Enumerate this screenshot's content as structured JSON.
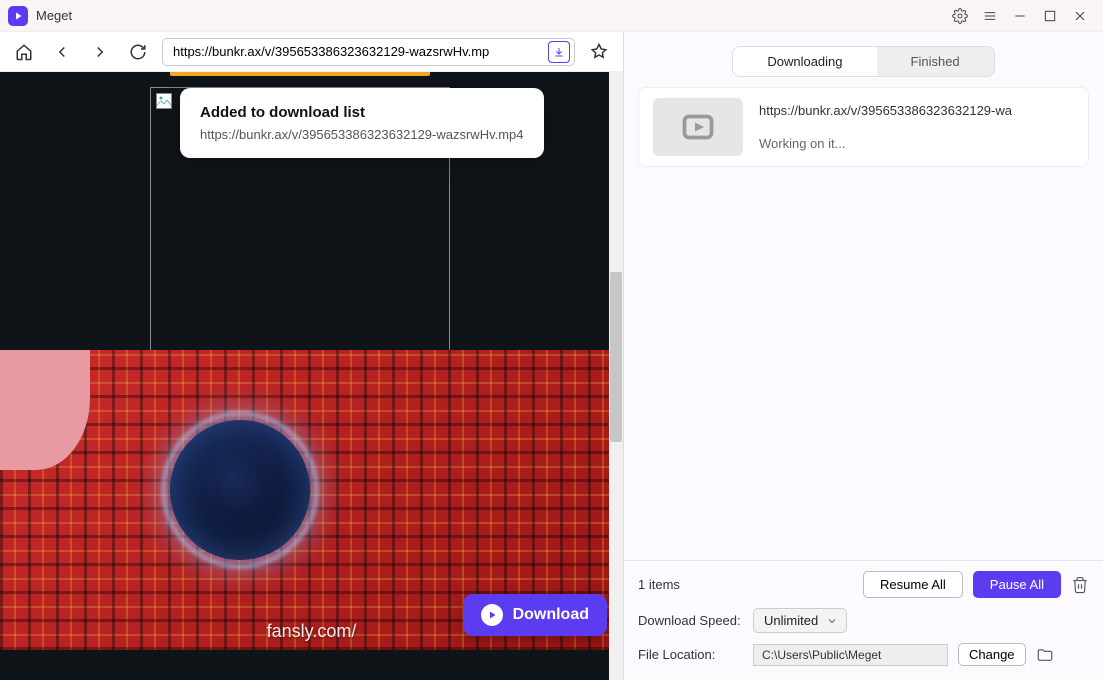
{
  "app": {
    "title": "Meget"
  },
  "nav": {
    "url": "https://bunkr.ax/v/395653386323632129-wazsrwHv.mp"
  },
  "toast": {
    "title": "Added to download list",
    "url": "https://bunkr.ax/v/395653386323632129-wazsrwHv.mp4"
  },
  "video": {
    "watermark": "fansly.com/",
    "download_label": "Download"
  },
  "tabs": {
    "downloading": "Downloading",
    "finished": "Finished"
  },
  "downloads": {
    "items": [
      {
        "url": "https://bunkr.ax/v/395653386323632129-wa",
        "status": "Working on it..."
      }
    ]
  },
  "footer": {
    "count": "1 items",
    "resume": "Resume All",
    "pause": "Pause All",
    "speed_label": "Download Speed:",
    "speed_value": "Unlimited",
    "location_label": "File Location:",
    "location_value": "C:\\Users\\Public\\Meget",
    "change": "Change"
  }
}
